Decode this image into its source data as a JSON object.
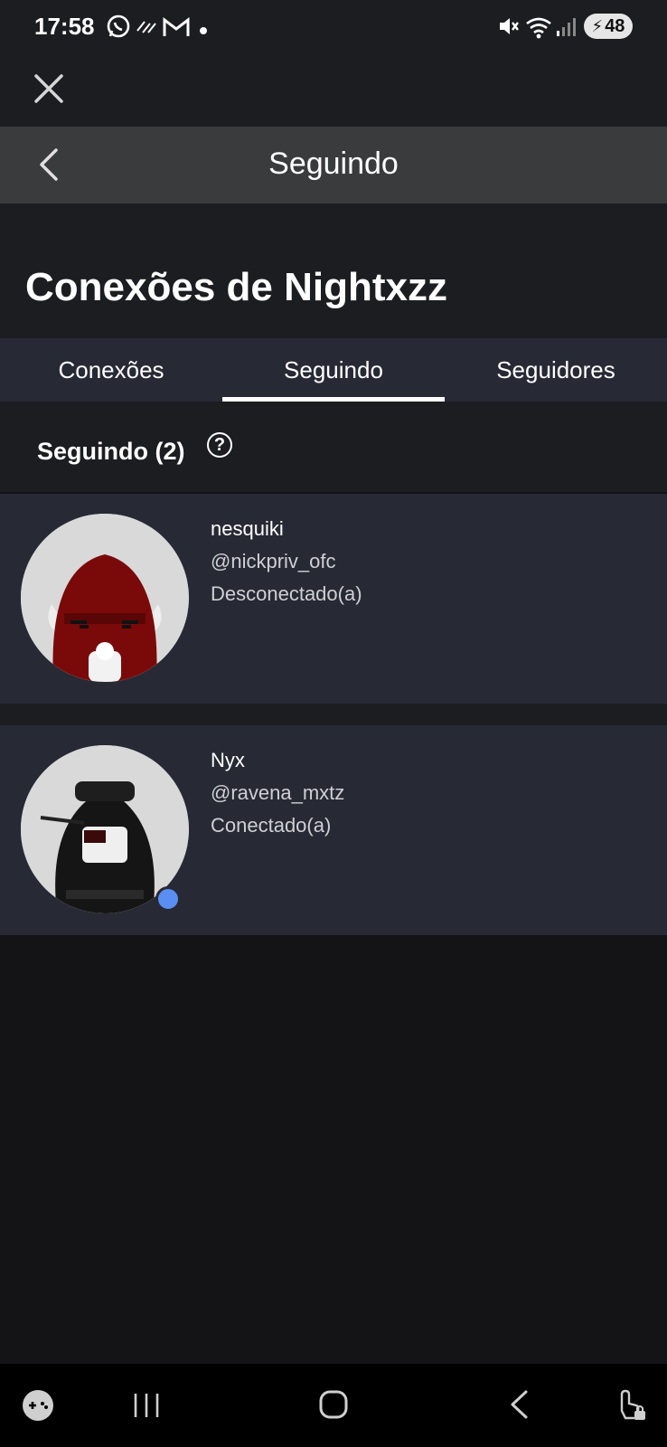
{
  "status_bar": {
    "time": "17:58",
    "battery": "48",
    "icons": [
      "whatsapp-icon",
      "data-saver-icon",
      "gmail-icon",
      "notification-dot-icon",
      "mute-icon",
      "wifi-icon",
      "signal-icon"
    ]
  },
  "header": {
    "title": "Seguindo"
  },
  "page": {
    "title": "Conexões de Nightxzz"
  },
  "tabs": [
    {
      "label": "Conexões",
      "active": false
    },
    {
      "label": "Seguindo",
      "active": true
    },
    {
      "label": "Seguidores",
      "active": false
    }
  ],
  "section": {
    "title": "Seguindo (2)",
    "help_glyph": "?"
  },
  "users": [
    {
      "name": "nesquiki",
      "handle": "@nickpriv_ofc",
      "status": "Desconectado(a)",
      "online": false
    },
    {
      "name": "Nyx",
      "handle": "@ravena_mxtz",
      "status": "Conectado(a)",
      "online": true
    }
  ],
  "colors": {
    "background": "#141416",
    "header": "#393b3d",
    "card": "#272935",
    "online": "#5b8ef2"
  }
}
